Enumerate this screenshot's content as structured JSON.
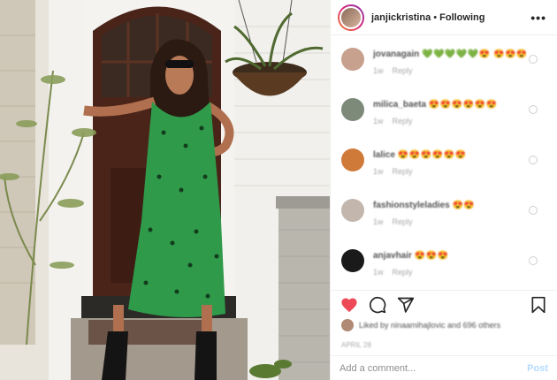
{
  "header": {
    "username": "janjickristina",
    "separator": "•",
    "follow_status": "Following",
    "more_icon": "more-horizontal-icon"
  },
  "comments": [
    {
      "user": "jovanagain",
      "emoji": "💚💚💚💚💚😍 😍😍😍",
      "meta_time": "1w",
      "meta_reply": "Reply",
      "avatar_color": "#c8a08e"
    },
    {
      "user": "milica_baeta",
      "emoji": "😍😍😍😍😍😍",
      "meta_time": "1w",
      "meta_reply": "Reply",
      "avatar_color": "#7d8a7a"
    },
    {
      "user": "lalice",
      "emoji": "😍😍😍😍😍😍",
      "meta_time": "1w",
      "meta_reply": "Reply",
      "avatar_color": "#d07a3a"
    },
    {
      "user": "fashionstyleladies",
      "emoji": "😍😍",
      "meta_time": "1w",
      "meta_reply": "Reply",
      "avatar_color": "#c2b6ad"
    },
    {
      "user": "anjavhair",
      "emoji": "😍😍😍",
      "meta_time": "1w",
      "meta_reply": "Reply",
      "avatar_color": "#1a1a1a"
    }
  ],
  "actions": {
    "like_icon": "heart-filled-icon",
    "comment_icon": "comment-icon",
    "share_icon": "share-icon",
    "save_icon": "bookmark-icon",
    "like_color": "#ed4956"
  },
  "likes": {
    "text": "Liked by ninaamihajlovic and 696 others"
  },
  "timestamp": "APRIL 28",
  "add_comment": {
    "placeholder": "Add a comment...",
    "post_label": "Post",
    "post_color": "#b3dbff"
  }
}
